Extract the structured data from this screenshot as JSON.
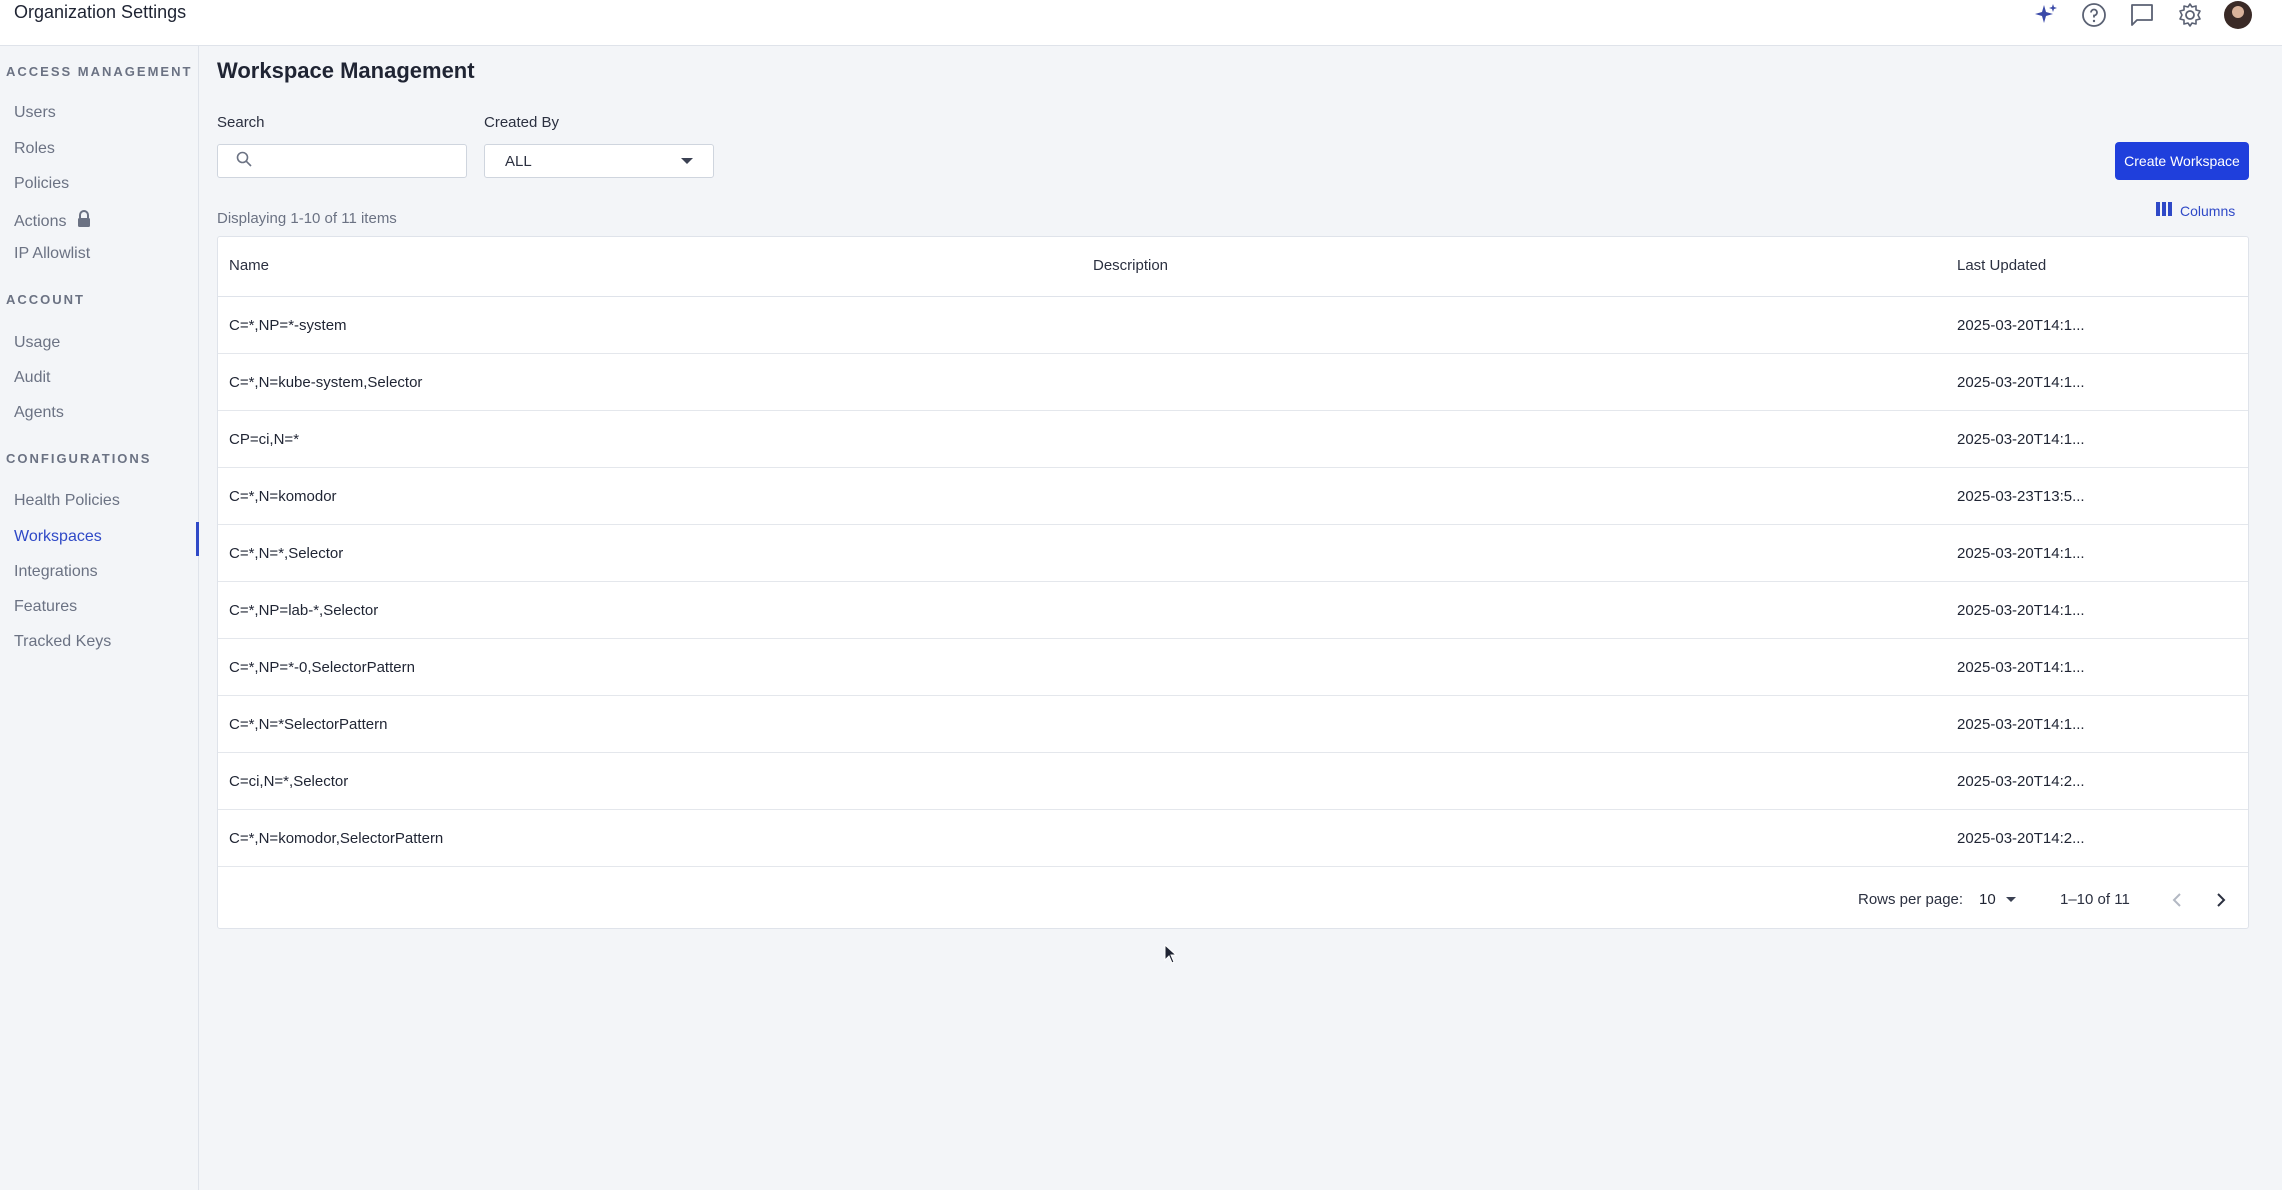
{
  "app": {
    "title": "Organization Settings"
  },
  "topbar": {
    "icons": [
      "sparkle-icon",
      "help-icon",
      "chat-icon",
      "gear-icon",
      "avatar"
    ]
  },
  "sidebar": {
    "sections": [
      {
        "title": "ACCESS MANAGEMENT",
        "items": [
          "Users",
          "Roles",
          "Policies",
          "Actions",
          "IP Allowlist"
        ]
      },
      {
        "title": "ACCOUNT",
        "items": [
          "Usage",
          "Audit",
          "Agents"
        ]
      },
      {
        "title": "CONFIGURATIONS",
        "items": [
          "Health Policies",
          "Workspaces",
          "Integrations",
          "Features",
          "Tracked Keys"
        ]
      }
    ],
    "active_item": "Workspaces",
    "locked_item": "Actions"
  },
  "main": {
    "title": "Workspace Management",
    "search": {
      "label": "Search",
      "value": "",
      "placeholder": ""
    },
    "created_by": {
      "label": "Created By",
      "value": "ALL"
    },
    "create_button": "Create Workspace",
    "displaying": "Displaying 1-10 of 11 items",
    "columns_button": "Columns",
    "table": {
      "headers": [
        "Name",
        "Description",
        "Last Updated"
      ],
      "rows": [
        {
          "name": "C=*,NP=*-system",
          "description": "",
          "updated": "2025-03-20T14:1..."
        },
        {
          "name": "C=*,N=kube-system,Selector",
          "description": "",
          "updated": "2025-03-20T14:1..."
        },
        {
          "name": "CP=ci,N=*",
          "description": "",
          "updated": "2025-03-20T14:1..."
        },
        {
          "name": "C=*,N=komodor",
          "description": "",
          "updated": "2025-03-23T13:5..."
        },
        {
          "name": "C=*,N=*,Selector",
          "description": "",
          "updated": "2025-03-20T14:1..."
        },
        {
          "name": "C=*,NP=lab-*,Selector",
          "description": "",
          "updated": "2025-03-20T14:1..."
        },
        {
          "name": "C=*,NP=*-0,SelectorPattern",
          "description": "",
          "updated": "2025-03-20T14:1..."
        },
        {
          "name": "C=*,N=*SelectorPattern",
          "description": "",
          "updated": "2025-03-20T14:1..."
        },
        {
          "name": "C=ci,N=*,Selector",
          "description": "",
          "updated": "2025-03-20T14:2..."
        },
        {
          "name": "C=*,N=komodor,SelectorPattern",
          "description": "",
          "updated": "2025-03-20T14:2..."
        }
      ]
    },
    "pagination": {
      "rows_per_page_label": "Rows per page:",
      "rows_per_page": "10",
      "range": "1–10 of 11"
    }
  },
  "colors": {
    "accent": "#1f3fdc",
    "active_nav": "#2f49c7",
    "background": "#f3f5f8"
  }
}
